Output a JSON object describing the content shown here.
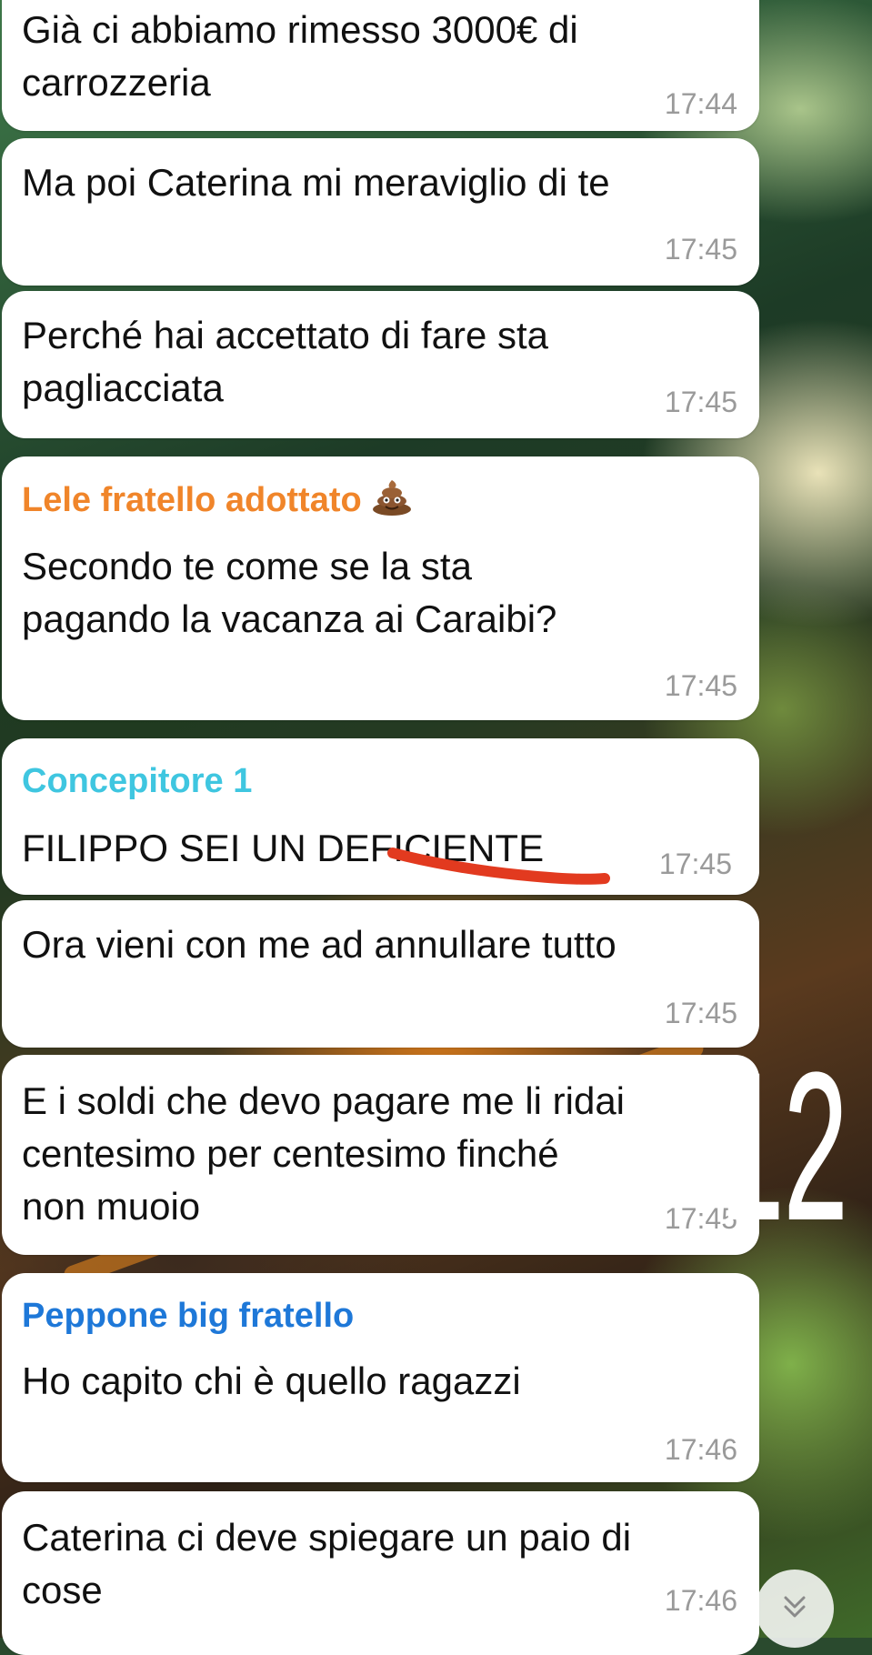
{
  "messages": [
    {
      "lines": [
        "Già ci abbiamo rimesso 3000€ di",
        "carrozzeria"
      ],
      "time": "17:44"
    },
    {
      "lines": [
        "Ma poi Caterina mi meraviglio di te"
      ],
      "time": "17:45"
    },
    {
      "lines": [
        "Perché hai accettato di fare sta",
        "pagliacciata"
      ],
      "time": "17:45"
    },
    {
      "sender": "Lele fratello adottato",
      "sender_color": "#f0852a",
      "sender_emoji": "pile-of-poo-icon",
      "lines": [
        "Secondo te come se la sta",
        "pagando la vacanza ai Caraibi?"
      ],
      "time": "17:45"
    },
    {
      "sender": "Concepitore 1",
      "sender_color": "#3fc6e0",
      "lines": [
        "FILIPPO SEI UN DEFICIENTE"
      ],
      "time": "17:45"
    },
    {
      "lines": [
        "Ora vieni con me ad annullare tutto"
      ],
      "time": "17:45"
    },
    {
      "lines": [
        "E i soldi che devo pagare me li ridai",
        "centesimo per centesimo finché",
        "non muoio"
      ],
      "time": "17:45"
    },
    {
      "sender": "Peppone big fratello",
      "sender_color": "#1e78d8",
      "lines": [
        "Ho capito chi è quello ragazzi"
      ],
      "time": "17:46"
    },
    {
      "lines": [
        "Caterina ci deve spiegare un paio di",
        "cose"
      ],
      "time": "17:46"
    }
  ],
  "annotation": {
    "text": "12",
    "color": "#ffffff"
  },
  "underline_color": "#e23a1f",
  "scroll_button": {
    "icon": "double-chevron-down-icon"
  }
}
